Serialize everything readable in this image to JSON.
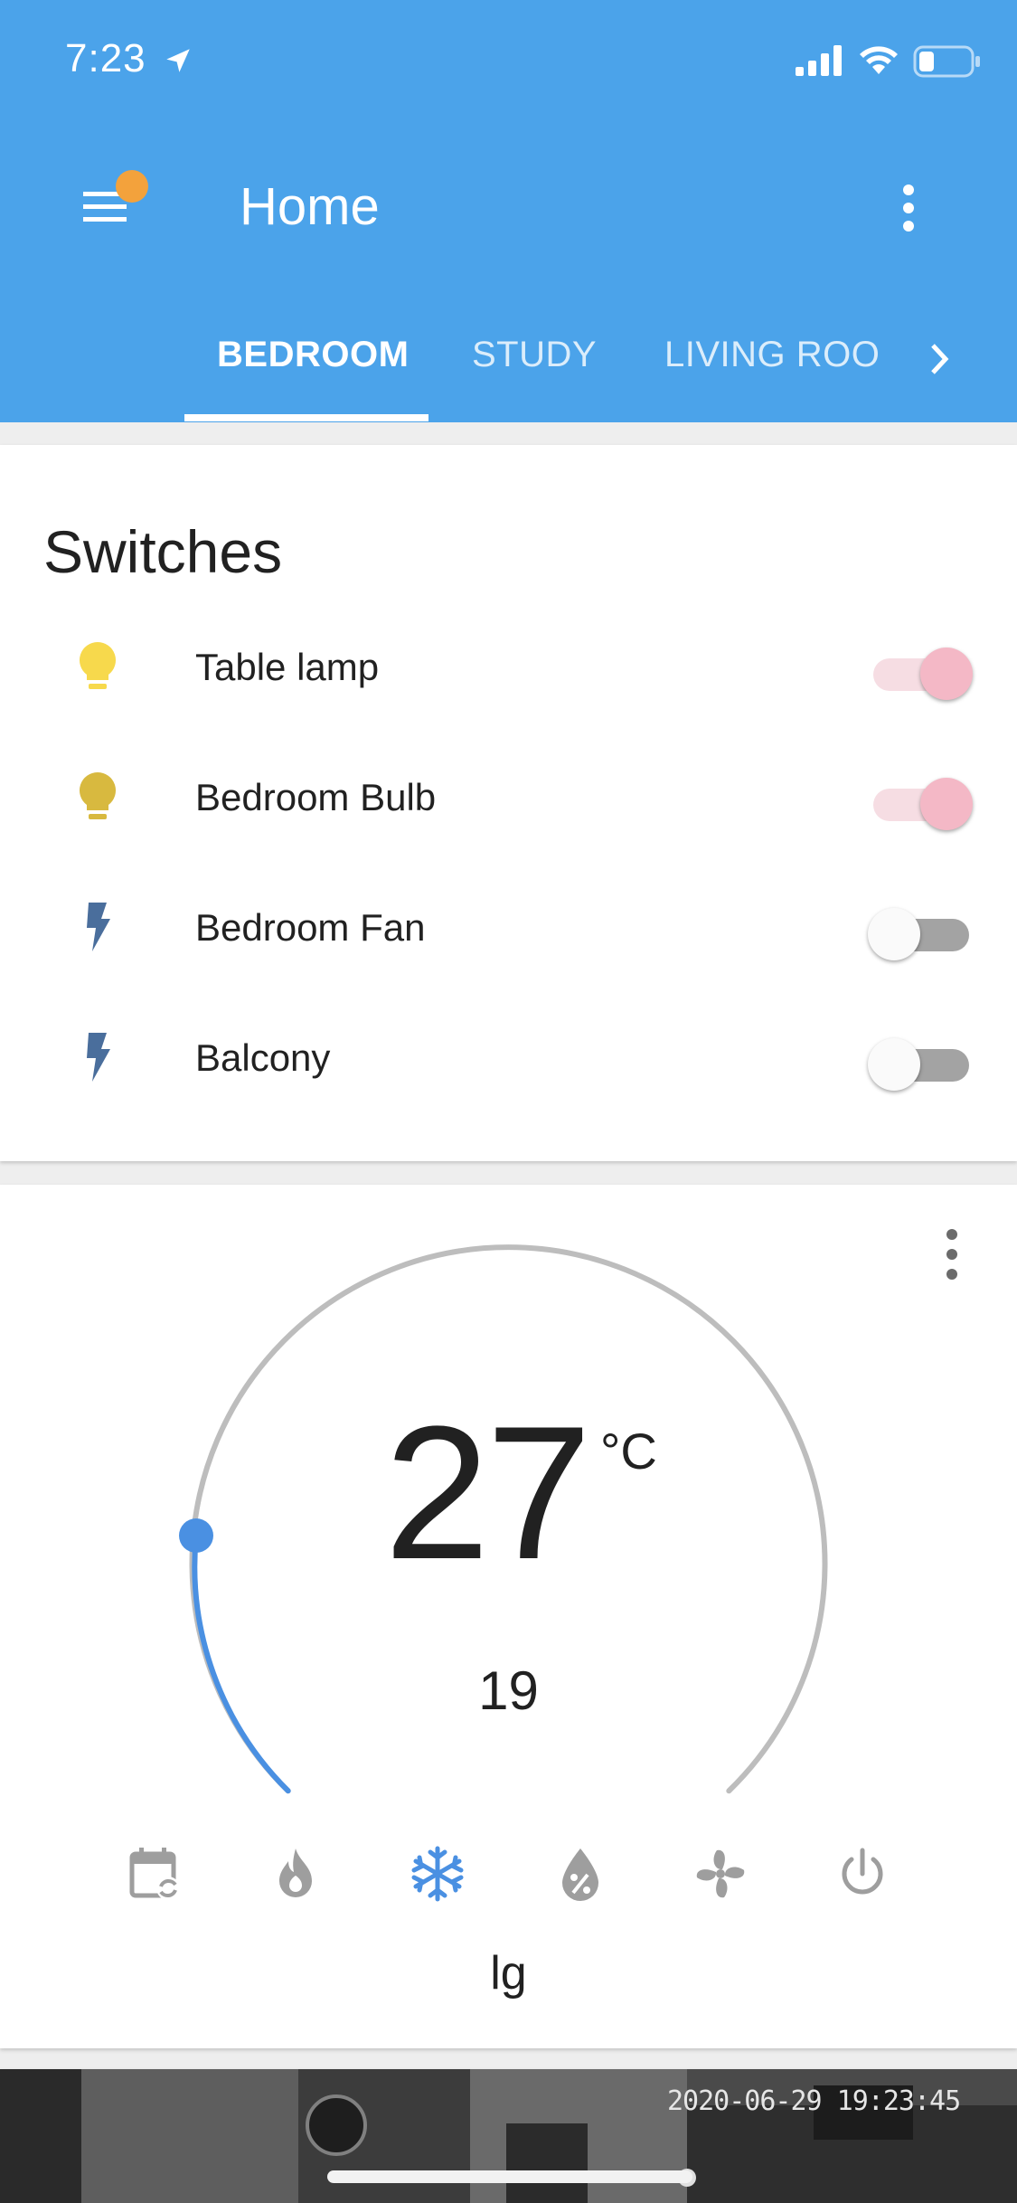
{
  "status": {
    "time": "7:23"
  },
  "header": {
    "title": "Home",
    "tabs": [
      {
        "label": "BEDROOM",
        "active": true
      },
      {
        "label": "STUDY",
        "active": false
      },
      {
        "label": "LIVING ROO",
        "active": false
      }
    ]
  },
  "switches": {
    "title": "Switches",
    "items": [
      {
        "label": "Table lamp",
        "icon": "lightbulb-icon",
        "on": true
      },
      {
        "label": "Bedroom Bulb",
        "icon": "lightbulb-icon",
        "on": true
      },
      {
        "label": "Bedroom Fan",
        "icon": "flash-icon",
        "on": false
      },
      {
        "label": "Balcony",
        "icon": "flash-icon",
        "on": false
      }
    ]
  },
  "thermostat": {
    "current_temp": "27",
    "unit": "°C",
    "target_temp": "19",
    "name": "lg",
    "modes": [
      "calendar-sync-icon",
      "fire-icon",
      "snowflake-icon",
      "water-percent-icon",
      "fan-icon",
      "power-icon"
    ],
    "active_mode": "snowflake-icon"
  },
  "camera": {
    "timestamp": "2020-06-29 19:23:45"
  },
  "colors": {
    "header": "#4ba3ea",
    "accent": "#4a90e2",
    "toggle_on": "#f4b8c6",
    "notification": "#f3a23c"
  }
}
